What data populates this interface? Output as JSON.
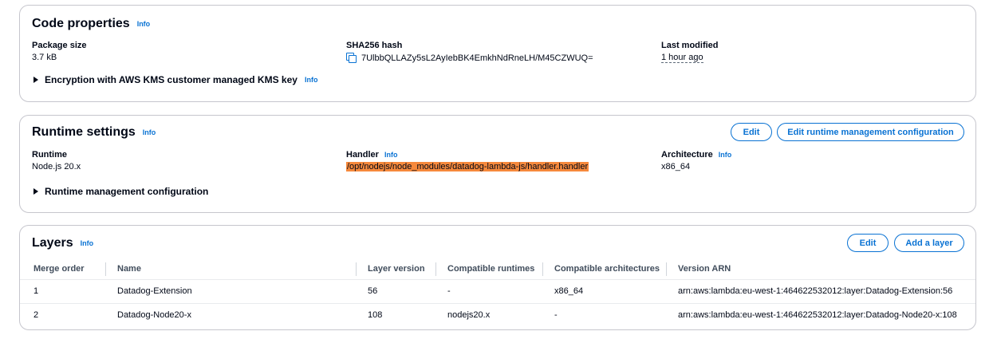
{
  "info_label": "Info",
  "code_properties": {
    "title": "Code properties",
    "package_size": {
      "label": "Package size",
      "value": "3.7 kB"
    },
    "sha256": {
      "label": "SHA256 hash",
      "value": "7UlbbQLLAZy5sL2AyIebBK4EmkhNdRneLH/M45CZWUQ="
    },
    "last_modified": {
      "label": "Last modified",
      "value": "1 hour ago"
    },
    "encryption_expander": "Encryption with AWS KMS customer managed KMS key"
  },
  "runtime_settings": {
    "title": "Runtime settings",
    "edit_button": "Edit",
    "edit_runtime_mgmt_button": "Edit runtime management configuration",
    "runtime": {
      "label": "Runtime",
      "value": "Node.js 20.x"
    },
    "handler": {
      "label": "Handler",
      "value": "/opt/nodejs/node_modules/datadog-lambda-js/handler.handler"
    },
    "architecture": {
      "label": "Architecture",
      "value": "x86_64"
    },
    "runtime_mgmt_expander": "Runtime management configuration"
  },
  "layers": {
    "title": "Layers",
    "edit_button": "Edit",
    "add_layer_button": "Add a layer",
    "columns": [
      "Merge order",
      "Name",
      "Layer version",
      "Compatible runtimes",
      "Compatible architectures",
      "Version ARN"
    ],
    "rows": [
      [
        "1",
        "Datadog-Extension",
        "56",
        "-",
        "x86_64",
        "arn:aws:lambda:eu-west-1:464622532012:layer:Datadog-Extension:56"
      ],
      [
        "2",
        "Datadog-Node20-x",
        "108",
        "nodejs20.x",
        "-",
        "arn:aws:lambda:eu-west-1:464622532012:layer:Datadog-Node20-x:108"
      ]
    ]
  },
  "colors": {
    "accent": "#0972d3",
    "highlight": "#f6893c",
    "border": "#c6c6cd"
  }
}
